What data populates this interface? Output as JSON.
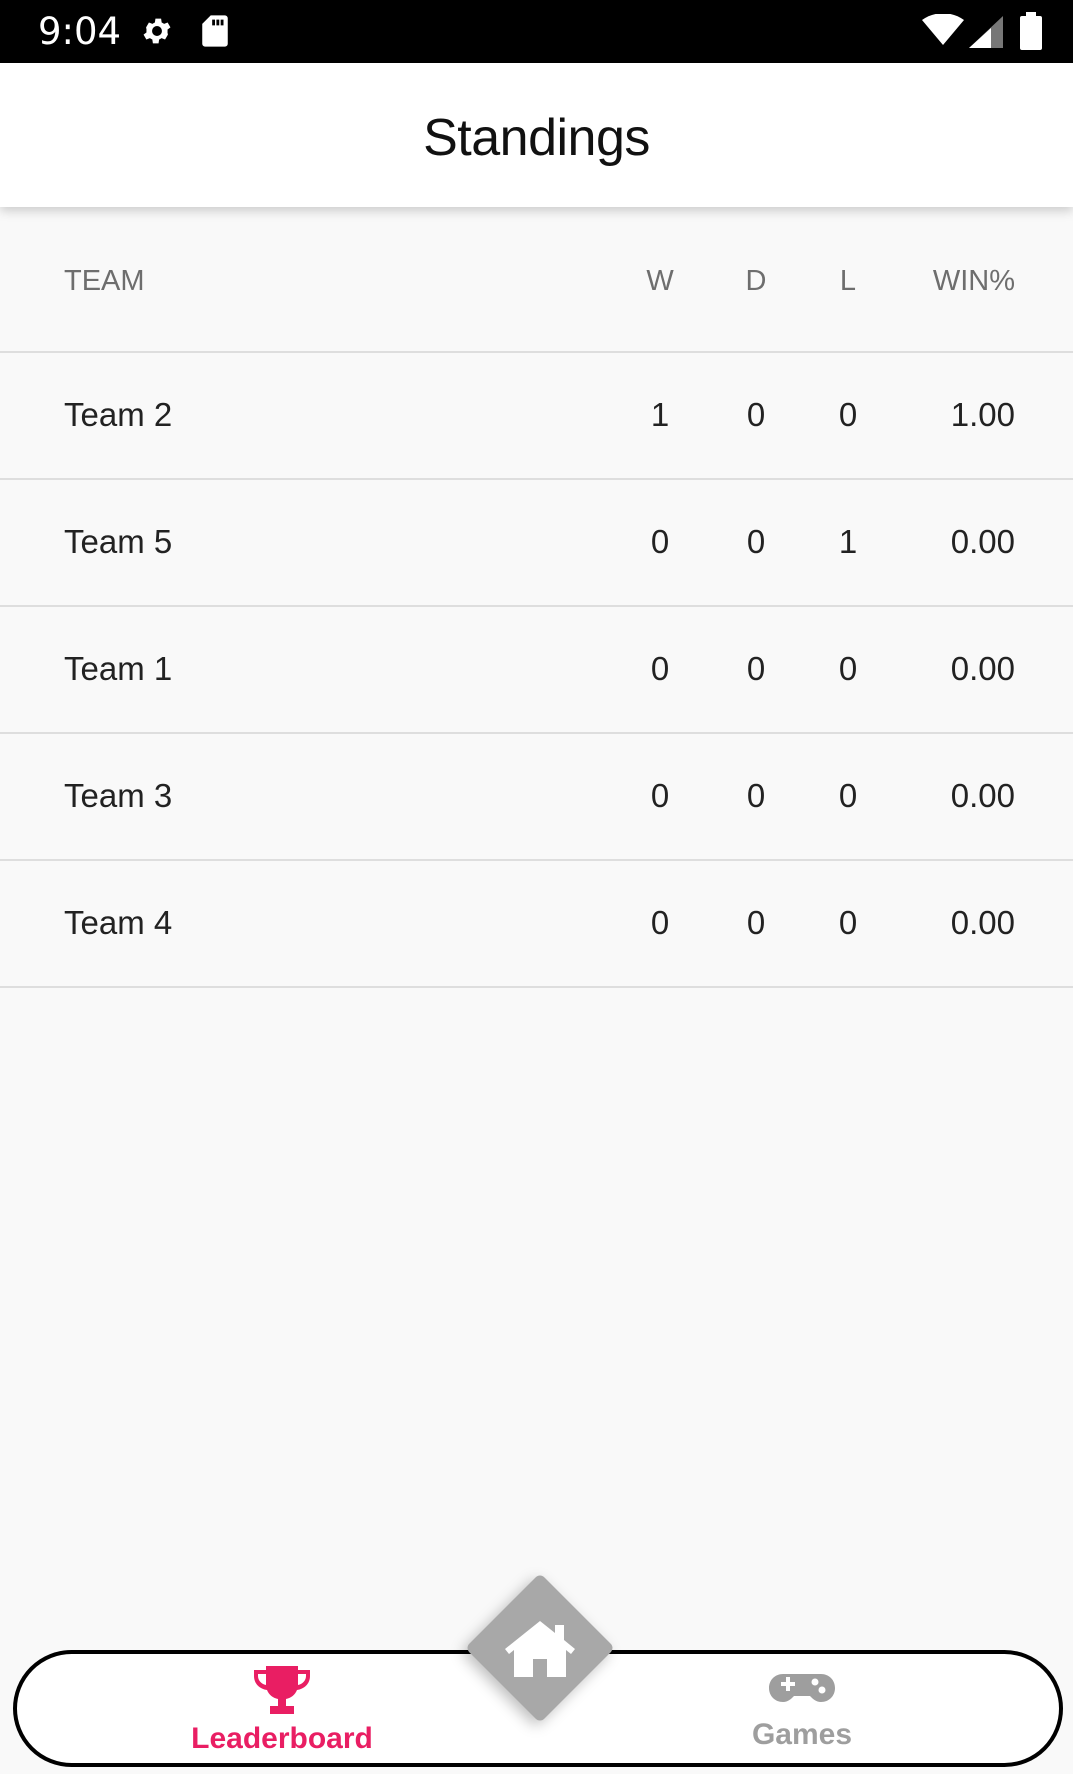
{
  "status_bar": {
    "time": "9:04",
    "icons": [
      "gear-icon",
      "sd-card-icon",
      "wifi-icon",
      "signal-icon",
      "battery-icon"
    ]
  },
  "app_bar": {
    "title": "Standings"
  },
  "table": {
    "headers": {
      "team": "TEAM",
      "w": "W",
      "d": "D",
      "l": "L",
      "pct": "WIN%"
    },
    "rows": [
      {
        "team": "Team 2",
        "w": "1",
        "d": "0",
        "l": "0",
        "pct": "1.00"
      },
      {
        "team": "Team 5",
        "w": "0",
        "d": "0",
        "l": "1",
        "pct": "0.00"
      },
      {
        "team": "Team 1",
        "w": "0",
        "d": "0",
        "l": "0",
        "pct": "0.00"
      },
      {
        "team": "Team 3",
        "w": "0",
        "d": "0",
        "l": "0",
        "pct": "0.00"
      },
      {
        "team": "Team 4",
        "w": "0",
        "d": "0",
        "l": "0",
        "pct": "0.00"
      }
    ]
  },
  "bottom_nav": {
    "items": [
      {
        "label": "Leaderboard",
        "icon": "trophy-icon",
        "active": true
      },
      {
        "label": "Games",
        "icon": "gamepad-icon",
        "active": false
      }
    ],
    "home_icon": "home-icon"
  },
  "colors": {
    "accent": "#e91e63",
    "inactive": "#9e9e9e",
    "fab": "#a8a8a8"
  }
}
